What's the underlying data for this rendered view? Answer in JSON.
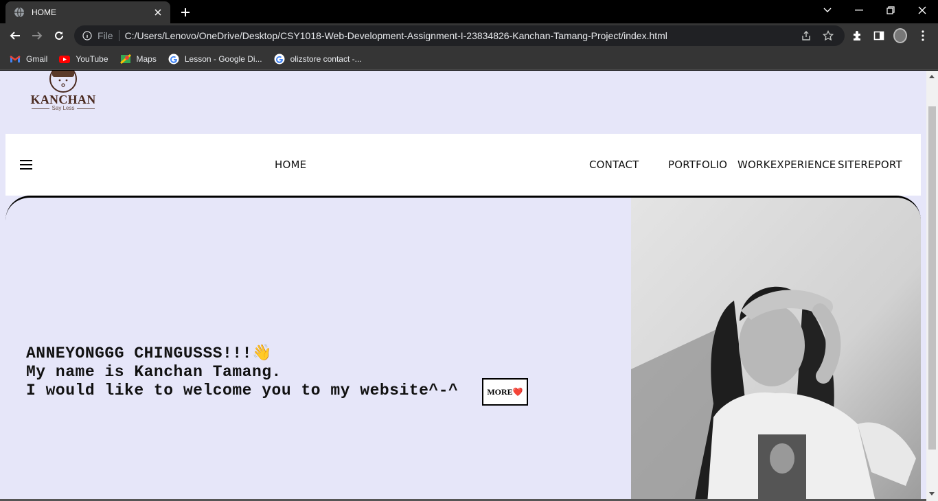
{
  "browser": {
    "tab_title": "HOME",
    "scheme_label": "File",
    "url": "C:/Users/Lenovo/OneDrive/Desktop/CSY1018-Web-Development-Assignment-I-23834826-Kanchan-Tamang-Project/index.html",
    "bookmarks": [
      {
        "label": "Gmail",
        "icon": "gmail-icon"
      },
      {
        "label": "YouTube",
        "icon": "youtube-icon"
      },
      {
        "label": "Maps",
        "icon": "maps-icon"
      },
      {
        "label": "Lesson - Google Di...",
        "icon": "google-icon"
      },
      {
        "label": "olizstore contact -...",
        "icon": "google-icon"
      }
    ]
  },
  "page": {
    "logo": {
      "wordmark": "KANCHAN",
      "tagline": "Say Less"
    },
    "nav": {
      "home": "HOME",
      "contact": "CONTACT",
      "portfolio": "PORTFOLIO",
      "work_experience": "WORKEXPERIENCE",
      "site_report": "SITEREPORT"
    },
    "hero": {
      "line1": "ANNEYONGGG CHINGUSSS!!!👋",
      "line2": "My name is Kanchan Tamang.",
      "line3": "I would like to welcome you to my website^-^",
      "more_button": "MORE❤️"
    }
  },
  "colors": {
    "page_bg": "#e6e6f9",
    "navbar_bg": "#ffffff",
    "chrome_bg": "#353535"
  }
}
